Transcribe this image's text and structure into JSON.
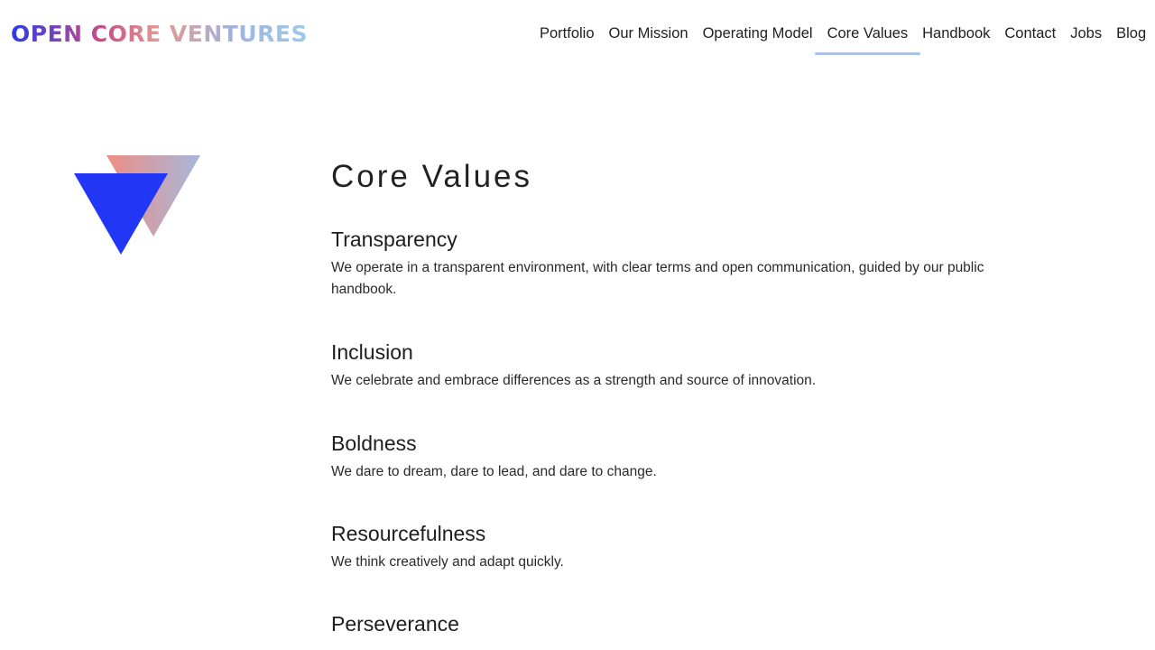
{
  "header": {
    "logo_text": "OPEN CORE VENTURES",
    "nav": [
      {
        "label": "Portfolio",
        "active": false
      },
      {
        "label": "Our Mission",
        "active": false
      },
      {
        "label": "Operating Model",
        "active": false
      },
      {
        "label": "Core Values",
        "active": true
      },
      {
        "label": "Handbook",
        "active": false
      },
      {
        "label": "Contact",
        "active": false
      },
      {
        "label": "Jobs",
        "active": false
      },
      {
        "label": "Blog",
        "active": false
      }
    ]
  },
  "colors": {
    "triangle_front": "#2236f5",
    "triangle_back_start": "#ee8e84",
    "triangle_back_end": "#a7b7dc",
    "active_underline": "#a9c4e6"
  },
  "main": {
    "title": "Core Values",
    "values": [
      {
        "title": "Transparency",
        "description": "We operate in a transparent environment, with clear terms and open communication, guided by our public handbook."
      },
      {
        "title": "Inclusion",
        "description": "We celebrate and embrace differences as a strength and source of innovation."
      },
      {
        "title": "Boldness",
        "description": "We dare to dream, dare to lead, and dare to change."
      },
      {
        "title": "Resourcefulness",
        "description": "We think creatively and adapt quickly."
      },
      {
        "title": "Perseverance",
        "description": ""
      }
    ]
  }
}
